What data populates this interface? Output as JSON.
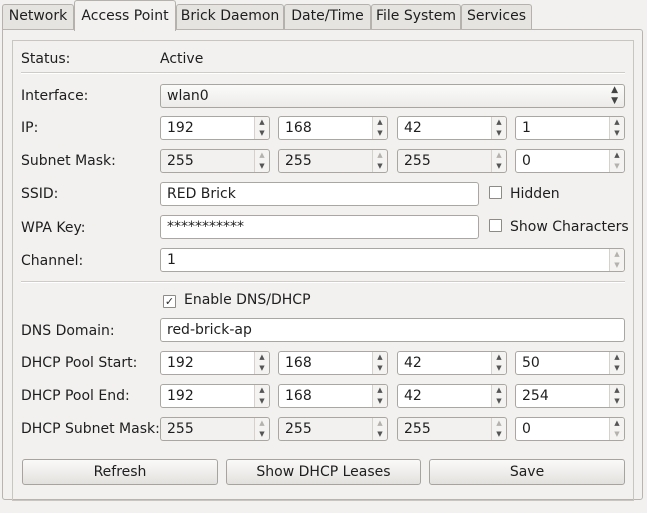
{
  "tabs": [
    "Network",
    "Access Point",
    "Brick Daemon",
    "Date/Time",
    "File System",
    "Services"
  ],
  "status": {
    "label": "Status:",
    "value": "Active"
  },
  "interface": {
    "label": "Interface:",
    "value": "wlan0"
  },
  "ip": {
    "label": "IP:",
    "octets": [
      "192",
      "168",
      "42",
      "1"
    ]
  },
  "subnet_mask": {
    "label": "Subnet Mask:",
    "octets": [
      "255",
      "255",
      "255",
      "0"
    ]
  },
  "ssid": {
    "label": "SSID:",
    "value": "RED Brick",
    "hidden_label": "Hidden",
    "hidden_checked": false
  },
  "wpa_key": {
    "label": "WPA Key:",
    "value": "***********",
    "show_label": "Show Characters",
    "show_checked": false
  },
  "channel": {
    "label": "Channel:",
    "value": "1"
  },
  "enable_dns_dhcp": {
    "label": "Enable DNS/DHCP",
    "checked": true,
    "mark": "✓"
  },
  "dns_domain": {
    "label": "DNS Domain:",
    "value": "red-brick-ap"
  },
  "dhcp_pool_start": {
    "label": "DHCP Pool Start:",
    "octets": [
      "192",
      "168",
      "42",
      "50"
    ]
  },
  "dhcp_pool_end": {
    "label": "DHCP Pool End:",
    "octets": [
      "192",
      "168",
      "42",
      "254"
    ]
  },
  "dhcp_subnet_mask": {
    "label": "DHCP Subnet Mask:",
    "octets": [
      "255",
      "255",
      "255",
      "0"
    ]
  },
  "buttons": {
    "refresh": "Refresh",
    "show_leases": "Show DHCP Leases",
    "save": "Save"
  },
  "icons": {
    "spin_up": "▲",
    "spin_down": "▼",
    "combo_up": "▲",
    "combo_down": "▼"
  }
}
